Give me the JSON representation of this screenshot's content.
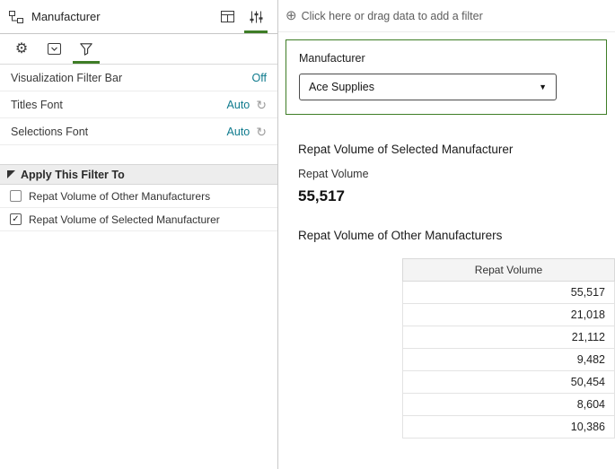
{
  "colors": {
    "accent_green": "#3E7D26",
    "link_teal": "#0E7A8D"
  },
  "icons": {
    "gear": "⚙",
    "reset": "↻",
    "add_circle": "⊕",
    "caret_down": "▼",
    "check": "✓"
  },
  "left_panel": {
    "header": {
      "title": "Manufacturer"
    },
    "properties": [
      {
        "label": "Visualization Filter Bar",
        "value": "Off"
      },
      {
        "label": "Titles Font",
        "value": "Auto"
      },
      {
        "label": "Selections Font",
        "value": "Auto"
      }
    ],
    "section": {
      "title": "Apply This Filter To"
    },
    "checkboxes": [
      {
        "label": "Repat Volume of Other Manufacturers",
        "checked": false
      },
      {
        "label": "Repat Volume of Selected Manufacturer",
        "checked": true
      }
    ]
  },
  "canvas": {
    "filter_bar": {
      "prompt": "Click here or drag data to add a filter"
    },
    "filter_card": {
      "label": "Manufacturer",
      "selected_value": "Ace Supplies"
    },
    "selected_viz": {
      "title": "Repat Volume of Selected Manufacturer",
      "metric_label": "Repat Volume",
      "metric_value": "55,517"
    },
    "others_viz": {
      "title": "Repat Volume of Other Manufacturers",
      "table": {
        "header": "Repat Volume",
        "rows": [
          "55,517",
          "21,018",
          "21,112",
          "9,482",
          "50,454",
          "8,604",
          "10,386"
        ]
      }
    }
  }
}
